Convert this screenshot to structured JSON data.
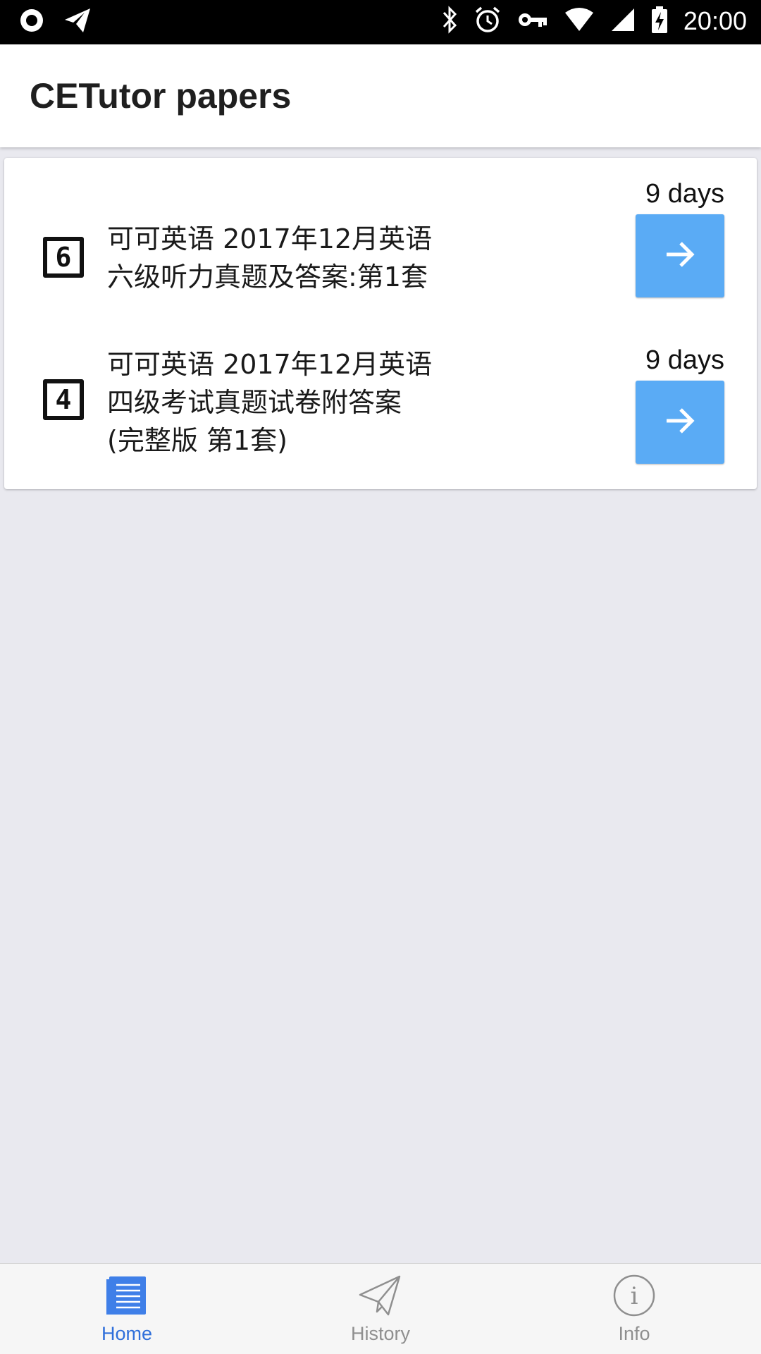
{
  "status_bar": {
    "time": "20:00",
    "left_icons": [
      "record-icon",
      "telegram-icon"
    ],
    "right_icons": [
      "bluetooth-icon",
      "alarm-icon",
      "vpn-key-icon",
      "wifi-icon",
      "cell-signal-icon",
      "battery-charging-icon"
    ]
  },
  "appbar": {
    "title": "CETutor papers"
  },
  "papers": [
    {
      "level_badge": "6",
      "title": "可可英语 2017年12月英语\n六级听力真题及答案:第1套",
      "days": "9 days",
      "action_icon": "arrow-right-icon"
    },
    {
      "level_badge": "4",
      "title": "可可英语 2017年12月英语\n四级考试真题试卷附答案\n(完整版 第1套)",
      "days": "9 days",
      "action_icon": "arrow-right-icon"
    }
  ],
  "bottom_nav": {
    "items": [
      {
        "label": "Home",
        "icon": "document-list-icon",
        "active": true
      },
      {
        "label": "History",
        "icon": "paper-plane-icon",
        "active": false
      },
      {
        "label": "Info",
        "icon": "info-circle-icon",
        "active": false
      }
    ]
  },
  "colors": {
    "accent": "#5aabf5",
    "active_tab": "#2f6fda",
    "inactive_tab": "#8f8f8f",
    "background": "#e9e9ef"
  }
}
